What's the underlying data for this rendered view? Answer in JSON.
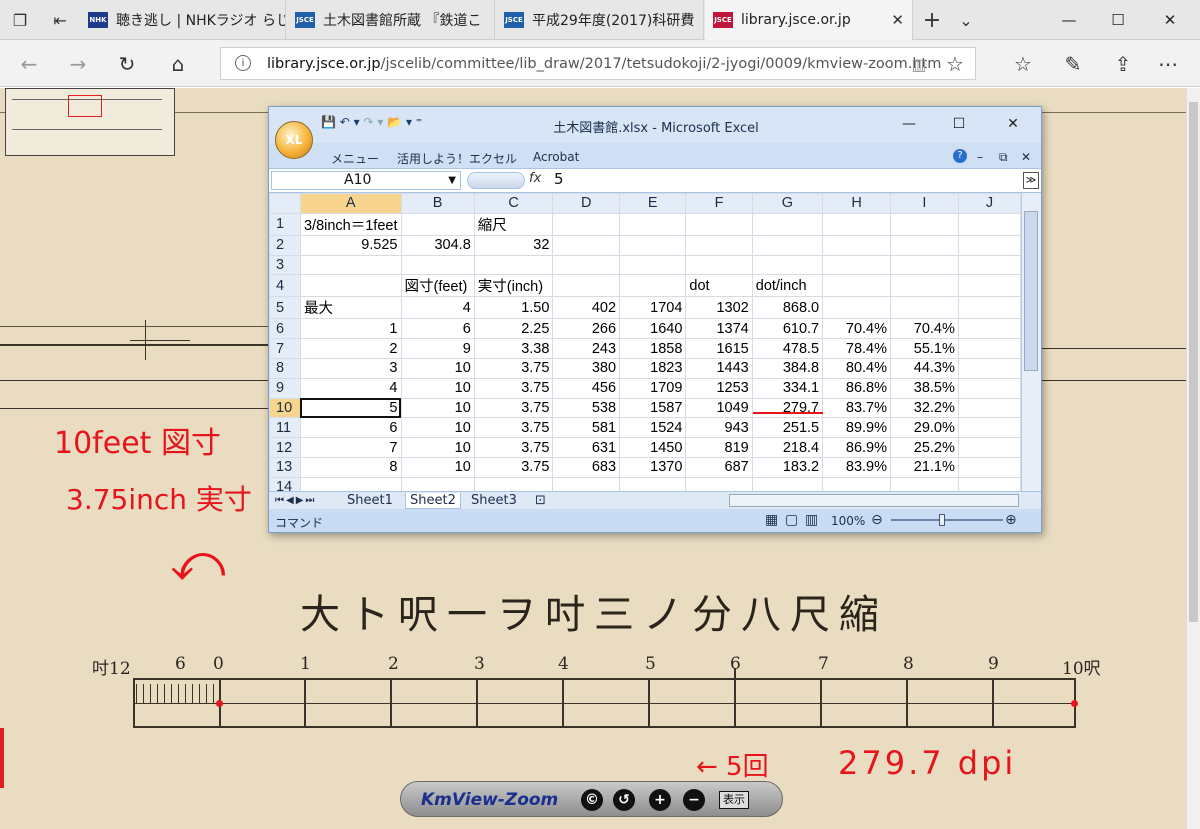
{
  "tabs": [
    {
      "label": "聴き逃し | NHKラジオ らじる",
      "favicon": "NHK",
      "favicon_color": "#1f3a8a"
    },
    {
      "label": "土木図書館所蔵 『鉄道こ",
      "favicon": "JSCE",
      "favicon_color": "#1f5fa8"
    },
    {
      "label": "平成29年度(2017)科研費",
      "favicon": "JSCE",
      "favicon_color": "#1f5fa8"
    },
    {
      "label": "library.jsce.or.jp",
      "favicon": "JSCE",
      "favicon_color": "#c0143c",
      "active": true
    }
  ],
  "address": {
    "domain": "library.jsce.or.jp",
    "path": "/jscelib/committee/lib_draw/2017/tetsudokoji/2-jyogi/0009/kmview-zoom.htm"
  },
  "excel": {
    "title": "土木図書館.xlsx - Microsoft Excel",
    "logo": "XL",
    "menu": [
      "メニュー",
      "活用しよう！エクセル",
      "Acrobat"
    ],
    "name_box": "A10",
    "fx": "fx",
    "formula_value": "5",
    "columns": [
      "A",
      "B",
      "C",
      "D",
      "E",
      "F",
      "G",
      "H",
      "I",
      "J"
    ],
    "rows": [
      {
        "n": "1",
        "cells": [
          "3/8inch＝1feet",
          "",
          "縮尺",
          "",
          "",
          "",
          "",
          "",
          "",
          ""
        ]
      },
      {
        "n": "2",
        "cells": [
          "9.525",
          "304.8",
          "32",
          "",
          "",
          "",
          "",
          "",
          "",
          ""
        ]
      },
      {
        "n": "3",
        "cells": [
          "",
          "",
          "",
          "",
          "",
          "",
          "",
          "",
          "",
          ""
        ]
      },
      {
        "n": "4",
        "cells": [
          "",
          "図寸(feet)",
          "実寸(inch)",
          "",
          "",
          "dot",
          "dot/inch",
          "",
          "",
          ""
        ]
      },
      {
        "n": "5",
        "cells": [
          "最大",
          "4",
          "1.50",
          "402",
          "1704",
          "1302",
          "868.0",
          "",
          "",
          ""
        ]
      },
      {
        "n": "6",
        "cells": [
          "1",
          "6",
          "2.25",
          "266",
          "1640",
          "1374",
          "610.7",
          "70.4%",
          "70.4%",
          ""
        ]
      },
      {
        "n": "7",
        "cells": [
          "2",
          "9",
          "3.38",
          "243",
          "1858",
          "1615",
          "478.5",
          "78.4%",
          "55.1%",
          ""
        ]
      },
      {
        "n": "8",
        "cells": [
          "3",
          "10",
          "3.75",
          "380",
          "1823",
          "1443",
          "384.8",
          "80.4%",
          "44.3%",
          ""
        ]
      },
      {
        "n": "9",
        "cells": [
          "4",
          "10",
          "3.75",
          "456",
          "1709",
          "1253",
          "334.1",
          "86.8%",
          "38.5%",
          ""
        ]
      },
      {
        "n": "10",
        "cells": [
          "5",
          "10",
          "3.75",
          "538",
          "1587",
          "1049",
          "279.7",
          "83.7%",
          "32.2%",
          ""
        ]
      },
      {
        "n": "11",
        "cells": [
          "6",
          "10",
          "3.75",
          "581",
          "1524",
          "943",
          "251.5",
          "89.9%",
          "29.0%",
          ""
        ]
      },
      {
        "n": "12",
        "cells": [
          "7",
          "10",
          "3.75",
          "631",
          "1450",
          "819",
          "218.4",
          "86.9%",
          "25.2%",
          ""
        ]
      },
      {
        "n": "13",
        "cells": [
          "8",
          "10",
          "3.75",
          "683",
          "1370",
          "687",
          "183.2",
          "83.9%",
          "21.1%",
          ""
        ]
      },
      {
        "n": "14",
        "cells": [
          "",
          "",
          "",
          "",
          "",
          "",
          "",
          "",
          "",
          ""
        ]
      }
    ],
    "sheets": [
      "Sheet1",
      "Sheet2",
      "Sheet3"
    ],
    "active_sheet": "Sheet2",
    "status_left": "コマンド",
    "zoom": "100%"
  },
  "drawing": {
    "title": "大ト呎一ヲ吋三ノ分八尺縮",
    "scale_labels": [
      "吋12",
      "6",
      "0",
      "1",
      "2",
      "3",
      "4",
      "5",
      "6",
      "7",
      "8",
      "9",
      "10呎"
    ]
  },
  "annotations": {
    "line1": "10feet 図寸",
    "line2": "3.75inch 実寸",
    "arrow": "⤺",
    "count": "← 5回",
    "dpi": "279.7 dpi"
  },
  "kmview": {
    "logo": "KmView-Zoom",
    "buttons": [
      "©",
      "↺",
      "+",
      "−"
    ],
    "show_label": "表示"
  },
  "colors": {
    "annotation_red": "#e8141c",
    "paper": "#e9dcc1",
    "excel_frame": "#c4d9f1"
  }
}
